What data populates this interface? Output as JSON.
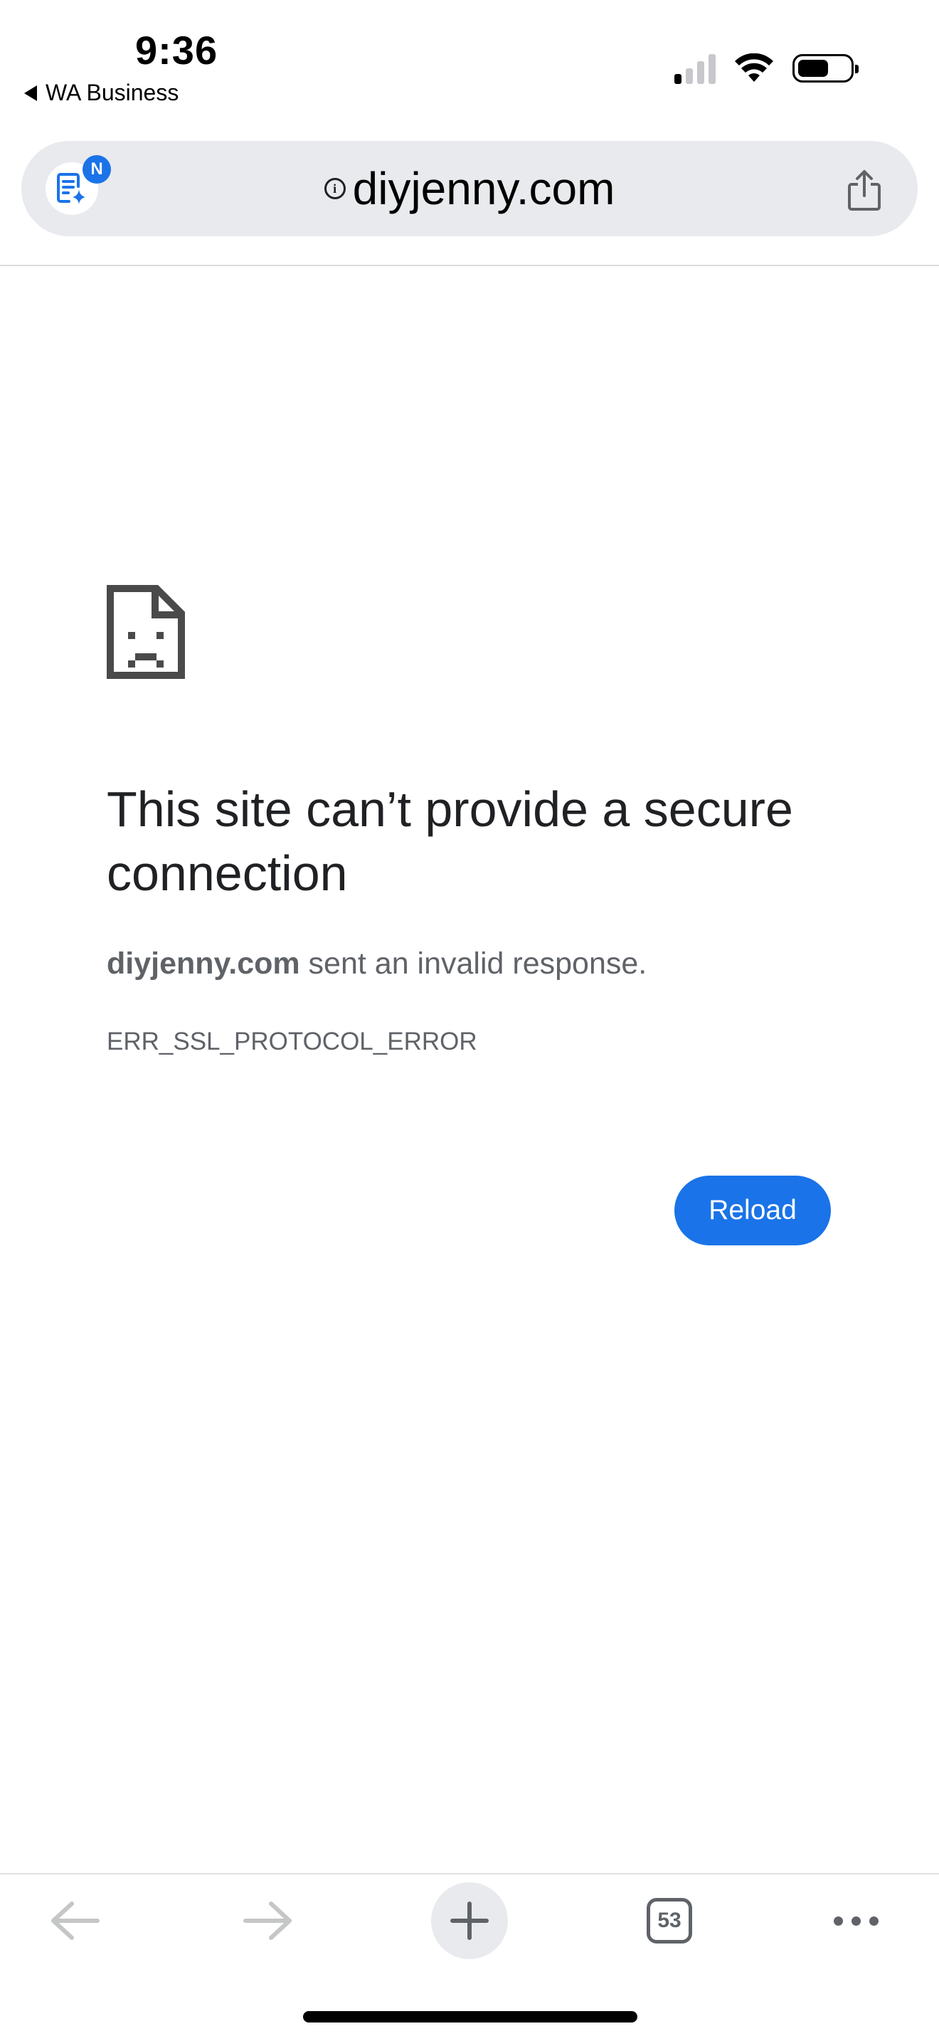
{
  "status_bar": {
    "time": "9:36",
    "back_app": "WA Business",
    "signal_bars_active": 1,
    "signal_bars_total": 4,
    "battery_level": 0.6
  },
  "address_bar": {
    "badge": "N",
    "url": "diyjenny.com"
  },
  "error": {
    "title": "This site can’t provide a secure connection",
    "domain": "diyjenny.com",
    "message": " sent an invalid response.",
    "code": "ERR_SSL_PROTOCOL_ERROR",
    "reload_label": "Reload"
  },
  "toolbar": {
    "tab_count": "53"
  },
  "colors": {
    "accent": "#1a73e8",
    "text_primary": "#202124",
    "text_secondary": "#5f6368"
  }
}
